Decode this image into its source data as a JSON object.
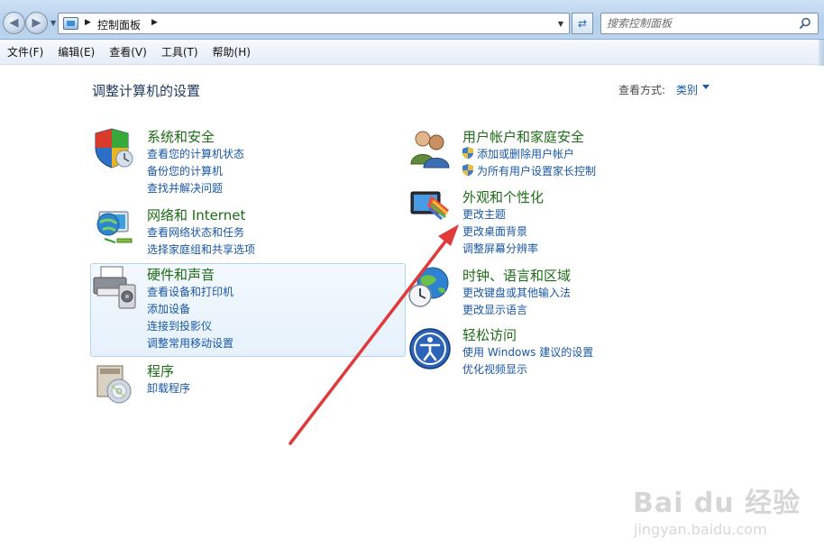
{
  "address_bar": {
    "breadcrumb": "控制面板",
    "search_placeholder": "搜索控制面板"
  },
  "menu": [
    "文件(F)",
    "编辑(E)",
    "查看(V)",
    "工具(T)",
    "帮助(H)"
  ],
  "page": {
    "heading": "调整计算机的设置",
    "view_by_label": "查看方式:",
    "view_by_value": "类别"
  },
  "categories": {
    "security": {
      "title": "系统和安全",
      "links": [
        "查看您的计算机状态",
        "备份您的计算机",
        "查找并解决问题"
      ]
    },
    "network": {
      "title": "网络和 Internet",
      "links": [
        "查看网络状态和任务",
        "选择家庭组和共享选项"
      ]
    },
    "hardware": {
      "title": "硬件和声音",
      "links": [
        "查看设备和打印机",
        "添加设备",
        "连接到投影仪",
        "调整常用移动设置"
      ]
    },
    "programs": {
      "title": "程序",
      "links": [
        "卸载程序"
      ]
    },
    "users": {
      "title": "用户帐户和家庭安全",
      "links": [
        "添加或删除用户帐户",
        "为所有用户设置家长控制"
      ]
    },
    "appearance": {
      "title": "外观和个性化",
      "links": [
        "更改主题",
        "更改桌面背景",
        "调整屏幕分辨率"
      ]
    },
    "clock": {
      "title": "时钟、语言和区域",
      "links": [
        "更改键盘或其他输入法",
        "更改显示语言"
      ]
    },
    "ease": {
      "title": "轻松访问",
      "links": [
        "使用 Windows 建议的设置",
        "优化视频显示"
      ]
    }
  },
  "watermark": {
    "brand": "Bai du 经验",
    "url": "jingyan.baidu.com"
  },
  "colors": {
    "category_title": "#1e6b16",
    "link": "#1a57a3",
    "annotation_arrow": "#e03a3a"
  }
}
